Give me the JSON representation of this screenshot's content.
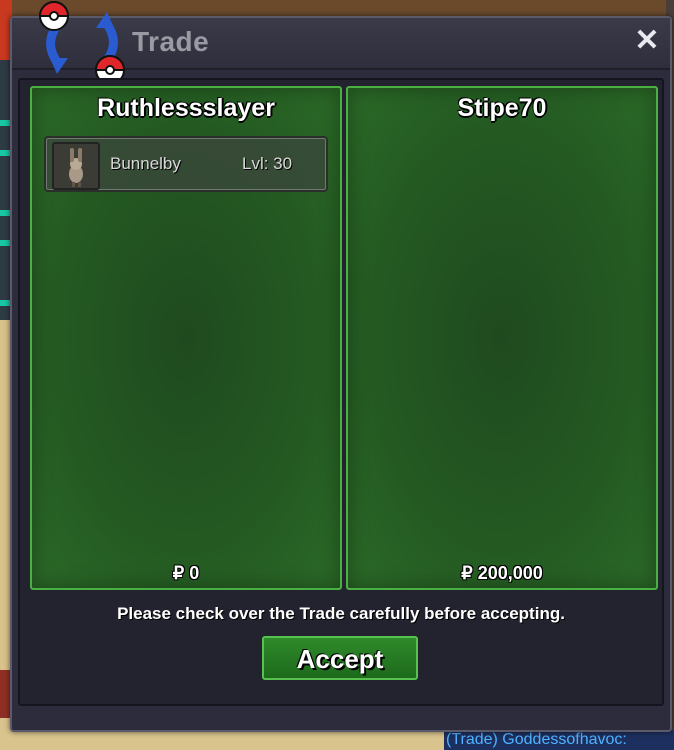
{
  "window": {
    "title": "Trade",
    "close_symbol": "✕"
  },
  "left_panel": {
    "player_name": "Ruthlessslayer",
    "items": [
      {
        "name": "Bunnelby",
        "level": "Lvl: 30"
      }
    ],
    "money": "₽ 0"
  },
  "right_panel": {
    "player_name": "Stipe70",
    "items": [],
    "money": "₽ 200,000"
  },
  "notice": "Please check over the Trade carefully before accepting.",
  "accept_label": "Accept",
  "chat": {
    "line": "(Trade) Goddessofhavoc:"
  },
  "colors": {
    "panel_green": "#245a22",
    "panel_border": "#4bb043",
    "window_bg": "#2c2c3c"
  },
  "icons": {
    "logo": "trade-pokeballs-icon",
    "sprite": "bunnelby-sprite-icon",
    "close": "close-icon"
  }
}
